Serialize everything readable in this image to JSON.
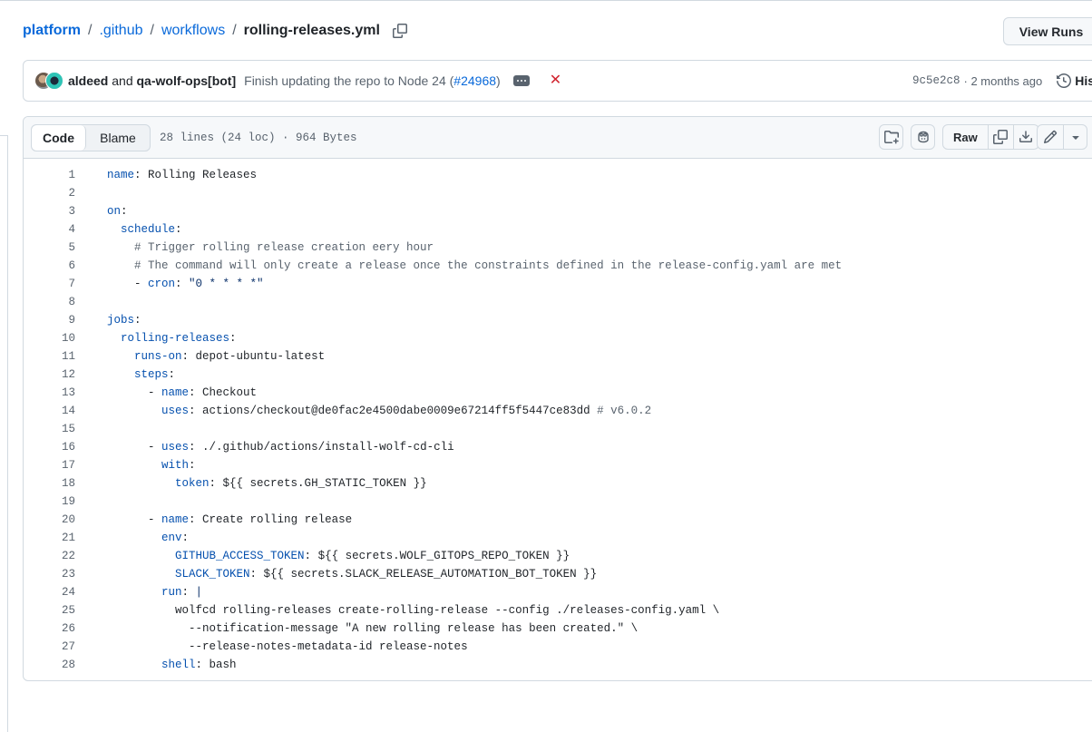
{
  "breadcrumb": {
    "root": "platform",
    "seg1": ".github",
    "seg2": "workflows",
    "file": "rolling-releases.yml",
    "sep": "/"
  },
  "header": {
    "view_runs_label": "View Runs"
  },
  "commit": {
    "author1": "aldeed",
    "and": "and",
    "author2": "qa-wolf-ops[bot]",
    "message": "Finish updating the repo to Node 24 (",
    "pr": "#24968",
    "message_end": ")",
    "sha": "9c5e2c8",
    "time": "· 2 months ago",
    "history_label": "Hist"
  },
  "file": {
    "tab_code": "Code",
    "tab_blame": "Blame",
    "info": "28 lines (24 loc) · 964 Bytes",
    "raw_label": "Raw"
  },
  "code": {
    "lines": [
      [
        [
          "k",
          "name"
        ],
        [
          "p",
          ": "
        ],
        [
          "v",
          "Rolling Releases"
        ]
      ],
      [],
      [
        [
          "k",
          "on"
        ],
        [
          "p",
          ":"
        ]
      ],
      [
        [
          "p",
          "  "
        ],
        [
          "k",
          "schedule"
        ],
        [
          "p",
          ":"
        ]
      ],
      [
        [
          "c",
          "    # Trigger rolling release creation eery hour"
        ]
      ],
      [
        [
          "c",
          "    # The command will only create a release once the constraints defined in the release-config.yaml are met"
        ]
      ],
      [
        [
          "p",
          "    - "
        ],
        [
          "k",
          "cron"
        ],
        [
          "p",
          ": "
        ],
        [
          "s",
          "\"0 * * * *\""
        ]
      ],
      [],
      [
        [
          "k",
          "jobs"
        ],
        [
          "p",
          ":"
        ]
      ],
      [
        [
          "p",
          "  "
        ],
        [
          "k",
          "rolling-releases"
        ],
        [
          "p",
          ":"
        ]
      ],
      [
        [
          "p",
          "    "
        ],
        [
          "k",
          "runs-on"
        ],
        [
          "p",
          ": "
        ],
        [
          "v",
          "depot-ubuntu-latest"
        ]
      ],
      [
        [
          "p",
          "    "
        ],
        [
          "k",
          "steps"
        ],
        [
          "p",
          ":"
        ]
      ],
      [
        [
          "p",
          "      - "
        ],
        [
          "k",
          "name"
        ],
        [
          "p",
          ": "
        ],
        [
          "v",
          "Checkout"
        ]
      ],
      [
        [
          "p",
          "        "
        ],
        [
          "k",
          "uses"
        ],
        [
          "p",
          ": "
        ],
        [
          "v",
          "actions/checkout@de0fac2e4500dabe0009e67214ff5f5447ce83dd "
        ],
        [
          "c",
          "# v6.0.2"
        ]
      ],
      [],
      [
        [
          "p",
          "      - "
        ],
        [
          "k",
          "uses"
        ],
        [
          "p",
          ": "
        ],
        [
          "v",
          "./.github/actions/install-wolf-cd-cli"
        ]
      ],
      [
        [
          "p",
          "        "
        ],
        [
          "k",
          "with"
        ],
        [
          "p",
          ":"
        ]
      ],
      [
        [
          "p",
          "          "
        ],
        [
          "k",
          "token"
        ],
        [
          "p",
          ": "
        ],
        [
          "v",
          "${{ secrets.GH_STATIC_TOKEN }}"
        ]
      ],
      [],
      [
        [
          "p",
          "      - "
        ],
        [
          "k",
          "name"
        ],
        [
          "p",
          ": "
        ],
        [
          "v",
          "Create rolling release"
        ]
      ],
      [
        [
          "p",
          "        "
        ],
        [
          "k",
          "env"
        ],
        [
          "p",
          ":"
        ]
      ],
      [
        [
          "p",
          "          "
        ],
        [
          "k",
          "GITHUB_ACCESS_TOKEN"
        ],
        [
          "p",
          ": "
        ],
        [
          "v",
          "${{ secrets.WOLF_GITOPS_REPO_TOKEN }}"
        ]
      ],
      [
        [
          "p",
          "          "
        ],
        [
          "k",
          "SLACK_TOKEN"
        ],
        [
          "p",
          ": "
        ],
        [
          "v",
          "${{ secrets.SLACK_RELEASE_AUTOMATION_BOT_TOKEN }}"
        ]
      ],
      [
        [
          "p",
          "        "
        ],
        [
          "k",
          "run"
        ],
        [
          "p",
          ": "
        ],
        [
          "s",
          "|"
        ]
      ],
      [
        [
          "v",
          "          wolfcd rolling-releases create-rolling-release --config ./releases-config.yaml \\"
        ]
      ],
      [
        [
          "v",
          "            --notification-message \"A new rolling release has been created.\" \\"
        ]
      ],
      [
        [
          "v",
          "            --release-notes-metadata-id release-notes"
        ]
      ],
      [
        [
          "p",
          "        "
        ],
        [
          "k",
          "shell"
        ],
        [
          "p",
          ": "
        ],
        [
          "v",
          "bash"
        ]
      ]
    ]
  }
}
